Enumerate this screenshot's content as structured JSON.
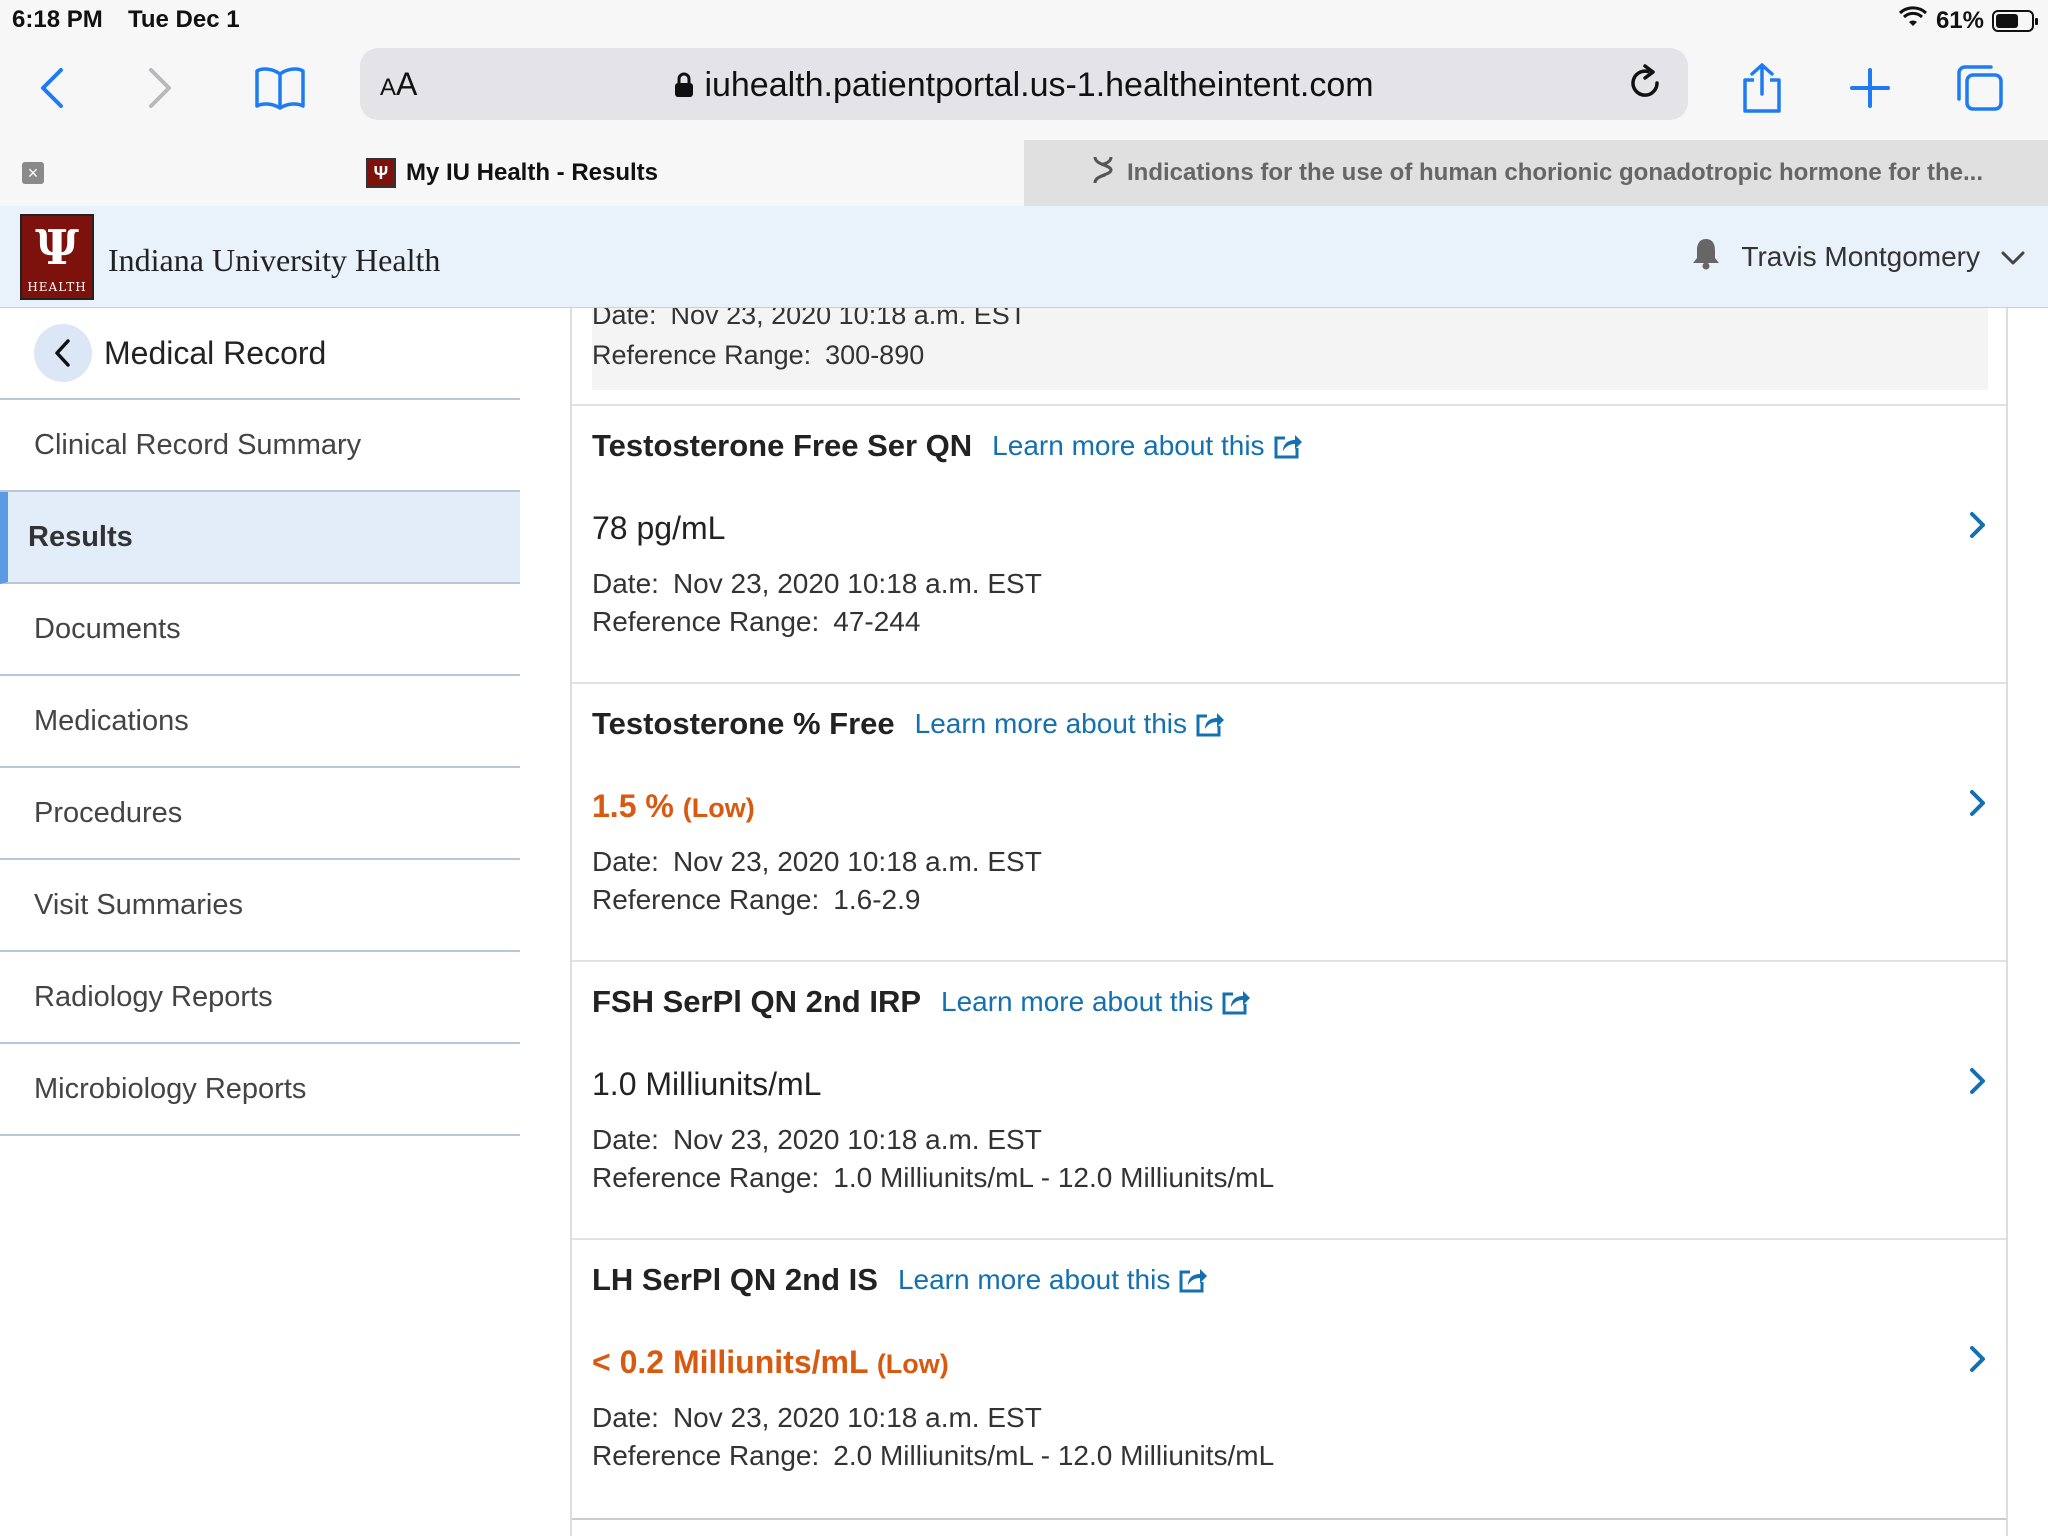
{
  "status": {
    "time": "6:18 PM",
    "date": "Tue Dec 1",
    "battery": "61%",
    "battery_level": 0.61
  },
  "browser": {
    "aa_small": "A",
    "aa_large": "A",
    "url": "iuhealth.patientportal.us-1.healtheintent.com",
    "tabs": [
      {
        "title": "My IU Health - Results"
      },
      {
        "title": "Indications for the use of human chorionic gonadotropic hormone for the..."
      }
    ]
  },
  "header": {
    "brand": "Indiana University Health",
    "logo_text": "HEALTH",
    "user": "Travis Montgomery"
  },
  "sidebar": {
    "title": "Medical Record",
    "items": [
      {
        "label": "Clinical Record Summary"
      },
      {
        "label": "Results"
      },
      {
        "label": "Documents"
      },
      {
        "label": "Medications"
      },
      {
        "label": "Procedures"
      },
      {
        "label": "Visit Summaries"
      },
      {
        "label": "Radiology Reports"
      },
      {
        "label": "Microbiology Reports"
      }
    ]
  },
  "labels": {
    "date": "Date:",
    "range": "Reference Range:",
    "learn": "Learn more about this"
  },
  "previous": {
    "date_partial": "Nov 23, 2020 10:18 a.m. EST",
    "range": "300-890"
  },
  "results": [
    {
      "name": "Testosterone Free Ser QN",
      "value": "78 pg/mL",
      "flag": "",
      "date": "Nov 23, 2020 10:18 a.m. EST",
      "range": "47-244"
    },
    {
      "name": "Testosterone % Free",
      "value": "1.5 %",
      "flag": "(Low)",
      "date": "Nov 23, 2020 10:18 a.m. EST",
      "range": "1.6-2.9"
    },
    {
      "name": "FSH SerPl QN 2nd IRP",
      "value": "1.0 Milliunits/mL",
      "flag": "",
      "date": "Nov 23, 2020 10:18 a.m. EST",
      "range": "1.0 Milliunits/mL - 12.0 Milliunits/mL"
    },
    {
      "name": "LH SerPl QN 2nd IS",
      "value": "< 0.2 Milliunits/mL",
      "flag": "(Low)",
      "date": "Nov 23, 2020 10:18 a.m. EST",
      "range": "2.0 Milliunits/mL - 12.0 Milliunits/mL"
    }
  ],
  "colors": {
    "link": "#1470af",
    "low": "#d85a10",
    "brand": "#7d110c",
    "active": "#5b9be6"
  }
}
